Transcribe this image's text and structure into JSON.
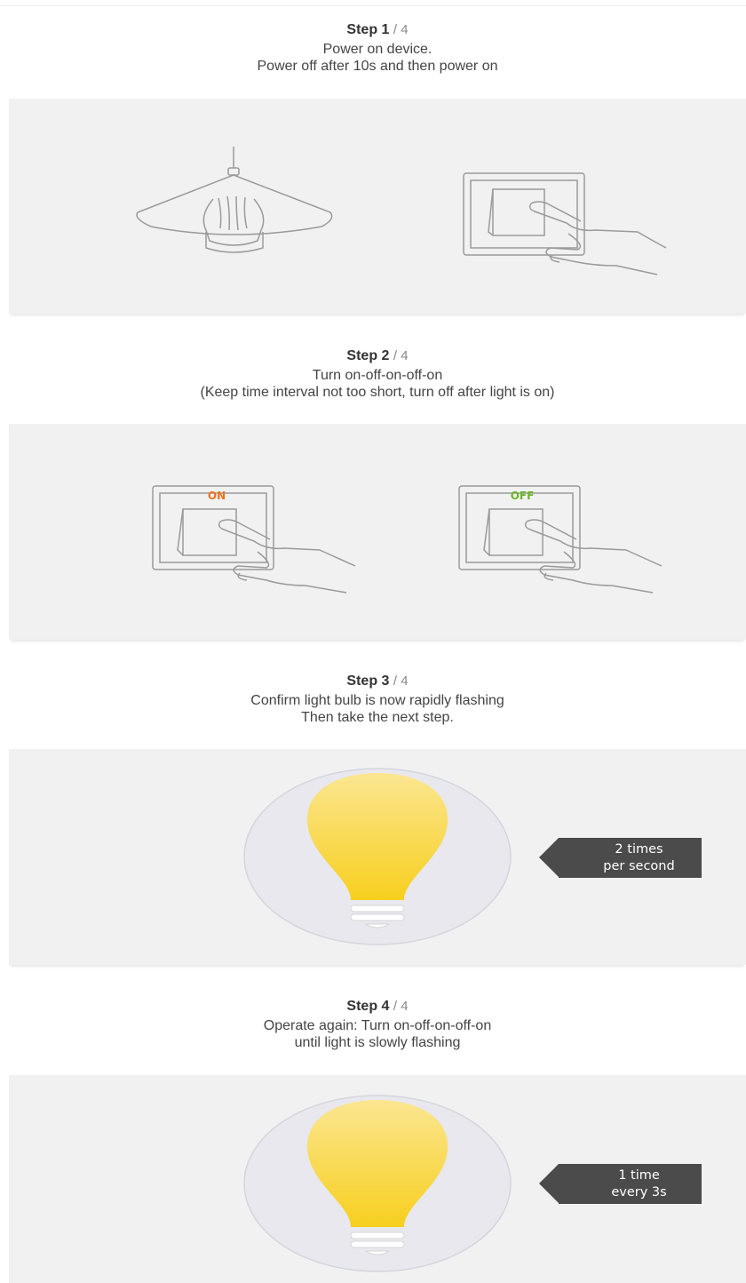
{
  "steps": [
    {
      "label": "Step 1",
      "total": "/ 4",
      "lines": [
        "Power on device.",
        "Power off after 10s and then power on"
      ]
    },
    {
      "label": "Step 2",
      "total": "/ 4",
      "lines": [
        "Turn on-off-on-off-on",
        "(Keep time interval not too short, turn off after light is on)"
      ],
      "switch_labels": [
        "ON",
        "OFF"
      ]
    },
    {
      "label": "Step 3",
      "total": "/ 4",
      "lines": [
        "Confirm light bulb is now rapidly flashing",
        "Then take the next step."
      ],
      "callout": [
        "2 times",
        "per second"
      ]
    },
    {
      "label": "Step 4",
      "total": "/ 4",
      "lines": [
        "Operate again: Turn on-off-on-off-on",
        "until light is slowly flashing"
      ],
      "callout": [
        "1 time",
        "every 3s"
      ]
    }
  ],
  "colors": {
    "panel_bg": "#f1f1f1",
    "on_label": "#f07020",
    "off_label": "#6cb52a",
    "bulb_yellow": "#f9d63a",
    "callout_bg": "#4b4b4b"
  },
  "icons": [
    "pendant-lamp-icon",
    "light-switch-icon",
    "bulb-icon"
  ]
}
